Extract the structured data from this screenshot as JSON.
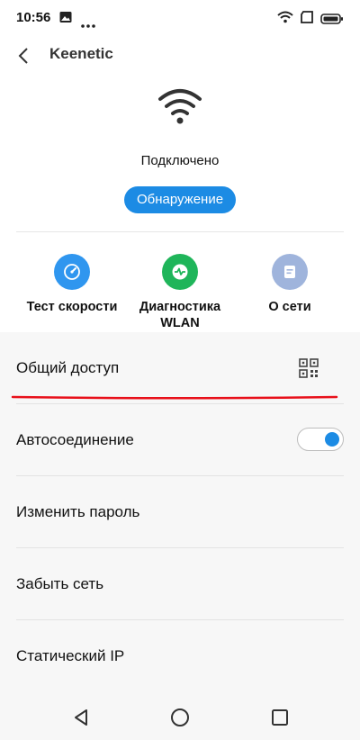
{
  "status_bar": {
    "time": "10:56",
    "icons": [
      "image-icon",
      "more-dots-icon",
      "wifi-icon",
      "sim-icon",
      "battery-icon"
    ]
  },
  "header": {
    "back_icon": "chevron-left-icon",
    "title": "Keenetic"
  },
  "network": {
    "icon": "wifi-icon",
    "status": "Подключено",
    "discover_label": "Обнаружение"
  },
  "actions": [
    {
      "label": "Тест скорости",
      "icon": "speedometer-icon",
      "color": "#2f96ef"
    },
    {
      "label": "Диагностика WLAN",
      "icon": "pulse-icon",
      "color": "#1fb55a"
    },
    {
      "label": "О сети",
      "icon": "document-icon",
      "color": "#9fb4dc"
    }
  ],
  "settings": [
    {
      "label": "Общий доступ",
      "icon": "qr-code-icon"
    },
    {
      "label": "Автосоединение",
      "toggle_on": true
    },
    {
      "label": "Изменить пароль"
    },
    {
      "label": "Забыть сеть"
    },
    {
      "label": "Статический IP"
    }
  ],
  "colors": {
    "accent": "#1c8be4",
    "annotation": "#e8101a",
    "list_background": "#f7f7f7"
  },
  "nav": {
    "back_icon": "triangle-back-icon",
    "home_icon": "circle-home-icon",
    "recents_icon": "square-recents-icon"
  }
}
